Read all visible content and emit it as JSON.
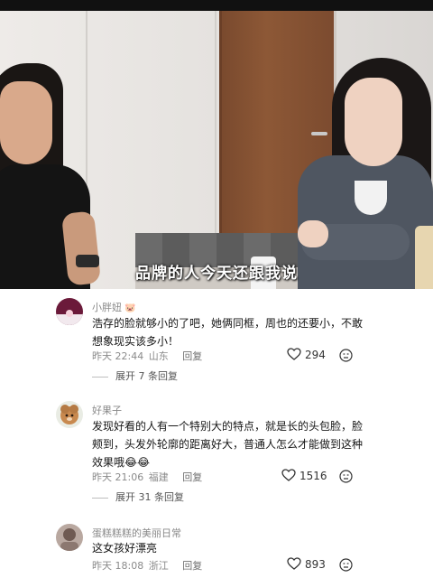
{
  "video": {
    "subtitle": "品牌的人今天还跟我说"
  },
  "comments": [
    {
      "username": "小胖妞",
      "badge": "🐷",
      "text": "浩存的脸就够小的了吧，她俩同框，周也的还要小，不敢想象现实该多小！",
      "time": "昨天 22:44",
      "location": "山东",
      "reply_label": "回复",
      "likes": "294",
      "expand_label": "展开 7 条回复"
    },
    {
      "username": "好果子",
      "badge": "",
      "text": "发现好看的人有一个特别大的特点，就是长的头包脸，脸颊到，头发外轮廓的距离好大，普通人怎么才能做到这种效果哦😂😂",
      "time": "昨天 21:06",
      "location": "福建",
      "reply_label": "回复",
      "likes": "1516",
      "expand_label": "展开 31 条回复"
    },
    {
      "username": "蛋糕糕糕的美丽日常",
      "badge": "",
      "text": "这女孩好漂亮",
      "time": "昨天 18:08",
      "location": "浙江",
      "reply_label": "回复",
      "likes": "893",
      "expand_label": ""
    }
  ],
  "icons": {
    "like": "heart-outline-icon",
    "dislike": "dislike-face-icon"
  },
  "colors": {
    "meta_gray": "#8a8a8a",
    "text_dark": "#161616",
    "subtitle_white": "#ffffff"
  }
}
